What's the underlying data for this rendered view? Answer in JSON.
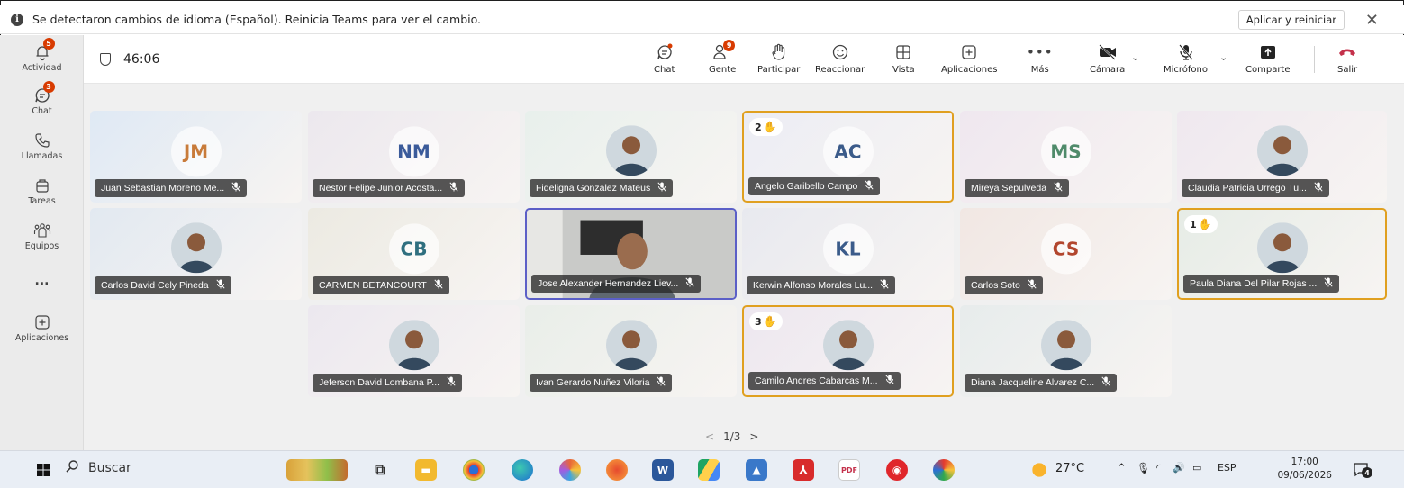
{
  "notification": {
    "message": "Se detectaron cambios de idioma (Español). Reinicia Teams para ver el cambio.",
    "apply_label": "Aplicar y reiniciar",
    "close_glyph": "✕"
  },
  "rail": {
    "items": [
      {
        "label": "Actividad",
        "icon": "bell-icon",
        "badge": "5"
      },
      {
        "label": "Chat",
        "icon": "chat-icon",
        "badge": "3"
      },
      {
        "label": "Llamadas",
        "icon": "phone-icon"
      },
      {
        "label": "Tareas",
        "icon": "tasks-icon"
      },
      {
        "label": "Equipos",
        "icon": "teams-icon"
      },
      {
        "label": "...",
        "icon": "more-icon"
      },
      {
        "label": "Aplicaciones",
        "icon": "apps-icon"
      }
    ]
  },
  "meeting": {
    "timer": "46:06",
    "toolbar": {
      "chat": "Chat",
      "people": "Gente",
      "people_badge": "9",
      "raise": "Participar",
      "react": "Reaccionar",
      "view": "Vista",
      "apps": "Aplicaciones",
      "more": "Más",
      "camera": "Cámara",
      "mic": "Micrófono",
      "share": "Comparte",
      "leave": "Salir"
    }
  },
  "participants": [
    {
      "name": "Juan Sebastian Moreno Me...",
      "initials": "JM",
      "kind": "initials",
      "color": "#c87b3a",
      "bg": "#dfe9f4"
    },
    {
      "name": "Nestor Felipe Junior Acosta...",
      "initials": "NM",
      "kind": "initials",
      "color": "#3b5b9a",
      "bg": "#ece8ee"
    },
    {
      "name": "Fideligna Gonzalez Mateus",
      "kind": "photo",
      "bg": "#e8f0ec"
    },
    {
      "name": "Angelo Garibello Campo",
      "initials": "AC",
      "kind": "initials",
      "color": "#3b5b8a",
      "bg": "#ecedf4",
      "hand": "2"
    },
    {
      "name": "Mireya Sepulveda",
      "initials": "MS",
      "kind": "initials",
      "color": "#4f8a6a",
      "bg": "#efe7ef"
    },
    {
      "name": "Claudia Patricia Urrego Tu...",
      "kind": "photo",
      "bg": "#efe8ef"
    },
    {
      "name": "Carlos David Cely Pineda",
      "kind": "photo",
      "bg": "#e2e9f1"
    },
    {
      "name": "CARMEN BETANCOURT",
      "initials": "CB",
      "kind": "initials",
      "color": "#2f6f7f",
      "bg": "#eceae2"
    },
    {
      "name": "Jose Alexander Hernandez Liev...",
      "kind": "video",
      "bg": "#8a8f8f"
    },
    {
      "name": "Kerwin Alfonso Morales Lu...",
      "initials": "KL",
      "kind": "initials",
      "color": "#3b5b8a",
      "bg": "#e8e9ef"
    },
    {
      "name": "Carlos Soto",
      "initials": "CS",
      "kind": "initials",
      "color": "#b2462e",
      "bg": "#f1e7e3"
    },
    {
      "name": "Paula Diana Del Pilar Rojas ...",
      "kind": "photo",
      "bg": "#e6ece6",
      "hand": "1"
    },
    {
      "name": "Jeferson David Lombana P...",
      "kind": "photo",
      "bg": "#ece8ef"
    },
    {
      "name": "Ivan Gerardo Nuñez Viloria",
      "kind": "photo",
      "bg": "#e9eee9"
    },
    {
      "name": "Camilo Andres Cabarcas M...",
      "kind": "photo",
      "bg": "#ede7f0",
      "hand": "3"
    },
    {
      "name": "Diana Jacqueline Alvarez C...",
      "kind": "photo",
      "bg": "#e7ecec"
    }
  ],
  "pager": {
    "prev": "<",
    "label": "1/3",
    "next": ">"
  },
  "taskbar": {
    "search_label": "Buscar",
    "weather": "27°C",
    "lang": "ESP",
    "time": "17:00",
    "date": "09/06/2026",
    "notif_count": "4"
  }
}
